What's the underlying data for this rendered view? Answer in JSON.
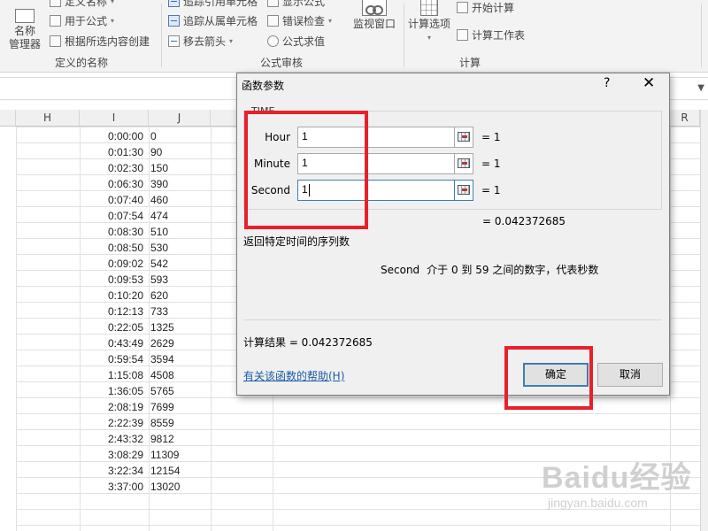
{
  "ribbon": {
    "defined_names": {
      "group_label": "定义的名称",
      "name_manager": [
        "名称",
        "管理器"
      ],
      "define_name": "定义名称",
      "use_in_formula": "用于公式",
      "create_from_selection": "根据所选内容创建"
    },
    "formula_auditing": {
      "group_label": "公式审核",
      "trace_precedents": "追踪引用单元格",
      "trace_dependents": "追踪从属单元格",
      "remove_arrows": "移去箭头",
      "show_formulas": "显示公式",
      "error_checking": "错误检查",
      "evaluate_formula": "公式求值",
      "watch_window": "监视窗口"
    },
    "calculation": {
      "group_label": "计算",
      "calc_options": "计算选项",
      "calc_now": "开始计算",
      "calc_sheet": "计算工作表"
    }
  },
  "columns": {
    "H": "H",
    "I": "I",
    "J": "J",
    "R": "R"
  },
  "rows": [
    {
      "time": "0:00:00",
      "value": "0"
    },
    {
      "time": "0:01:30",
      "value": "90"
    },
    {
      "time": "0:02:30",
      "value": "150"
    },
    {
      "time": "0:06:30",
      "value": "390"
    },
    {
      "time": "0:07:40",
      "value": "460"
    },
    {
      "time": "0:07:54",
      "value": "474"
    },
    {
      "time": "0:08:30",
      "value": "510"
    },
    {
      "time": "0:08:50",
      "value": "530"
    },
    {
      "time": "0:09:02",
      "value": "542"
    },
    {
      "time": "0:09:53",
      "value": "593"
    },
    {
      "time": "0:10:20",
      "value": "620"
    },
    {
      "time": "0:12:13",
      "value": "733"
    },
    {
      "time": "0:22:05",
      "value": "1325"
    },
    {
      "time": "0:43:49",
      "value": "2629"
    },
    {
      "time": "0:59:54",
      "value": "3594"
    },
    {
      "time": "1:15:08",
      "value": "4508"
    },
    {
      "time": "1:36:05",
      "value": "5765"
    },
    {
      "time": "2:08:19",
      "value": "7699"
    },
    {
      "time": "2:22:39",
      "value": "8559"
    },
    {
      "time": "2:43:32",
      "value": "9812"
    },
    {
      "time": "3:08:29",
      "value": "11309"
    },
    {
      "time": "3:22:34",
      "value": "12154"
    },
    {
      "time": "3:37:00",
      "value": "13020"
    }
  ],
  "dialog": {
    "title": "函数参数",
    "help_symbol": "?",
    "close_symbol": "✕",
    "function_name": "TIME",
    "args": [
      {
        "label": "Hour",
        "value": "1",
        "result": "=  1"
      },
      {
        "label": "Minute",
        "value": "1",
        "result": "=  1"
      },
      {
        "label": "Second",
        "value": "1",
        "result": "=  1"
      }
    ],
    "result_line": "=  0.042372685",
    "description": "返回特定时间的序列数",
    "arg_name": "Second",
    "arg_description": "介于 0 到 59 之间的数字，代表秒数",
    "calc_result": "计算结果 =   0.042372685",
    "help_link": "有关该函数的帮助(H)",
    "ok_label": "确定",
    "cancel_label": "取消"
  },
  "watermark": {
    "brand": "Baidu经验",
    "url": "jingyan.baidu.com"
  }
}
